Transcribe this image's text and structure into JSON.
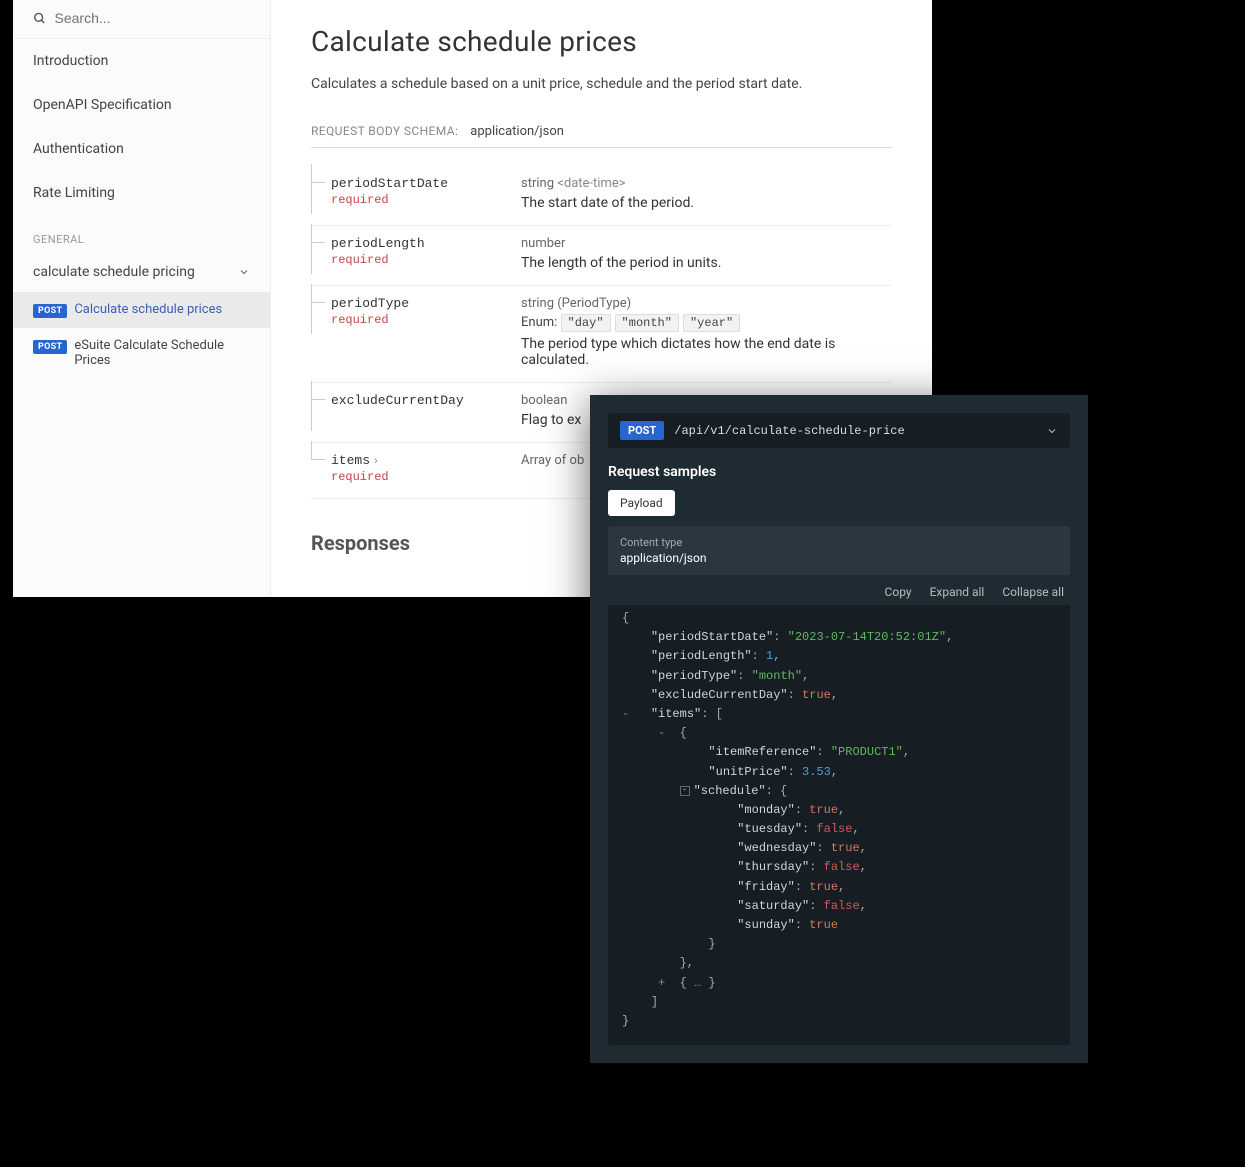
{
  "search": {
    "placeholder": "Search..."
  },
  "sidebar": {
    "items": [
      {
        "label": "Introduction"
      },
      {
        "label": "OpenAPI Specification"
      },
      {
        "label": "Authentication"
      },
      {
        "label": "Rate Limiting"
      }
    ],
    "section_header": "GENERAL",
    "group_label": "calculate schedule pricing",
    "api_items": [
      {
        "method": "POST",
        "label": "Calculate schedule prices",
        "active": true
      },
      {
        "method": "POST",
        "label": "eSuite Calculate Schedule Prices",
        "active": false
      }
    ]
  },
  "page": {
    "title": "Calculate schedule prices",
    "description": "Calculates a schedule based on a unit price, schedule and the period start date.",
    "schema_label": "REQUEST BODY SCHEMA:",
    "schema_content_type": "application/json",
    "responses_heading": "Responses"
  },
  "params": [
    {
      "name": "periodStartDate",
      "required": "required",
      "type": "string",
      "format": "<date-time>",
      "desc": "The start date of the period."
    },
    {
      "name": "periodLength",
      "required": "required",
      "type": "number",
      "format": "",
      "desc": "The length of the period in units."
    },
    {
      "name": "periodType",
      "required": "required",
      "type": "string (PeriodType)",
      "format": "",
      "enum_label": "Enum:",
      "enum": [
        "\"day\"",
        "\"month\"",
        "\"year\""
      ],
      "desc": "The period type which dictates how the end date is calculated."
    },
    {
      "name": "excludeCurrentDay",
      "required": "",
      "type": "boolean",
      "format": "",
      "desc": "Flag to ex"
    },
    {
      "name": "items",
      "required": "required",
      "type": "Array of ob",
      "format": "",
      "desc": "",
      "expandable": true
    }
  ],
  "sample": {
    "endpoint_method": "POST",
    "endpoint_path": "/api/v1/calculate-schedule-price",
    "section_title": "Request samples",
    "tab_label": "Payload",
    "content_type_label": "Content type",
    "content_type_value": "application/json",
    "toolbar": {
      "copy": "Copy",
      "expand": "Expand all",
      "collapse": "Collapse all"
    },
    "json": {
      "periodStartDate": "2023-07-14T20:52:01Z",
      "periodLength": 1,
      "periodType": "month",
      "excludeCurrentDay": true,
      "items": [
        {
          "itemReference": "PRODUCT1",
          "unitPrice": 3.53,
          "schedule": {
            "monday": true,
            "tuesday": false,
            "wednesday": true,
            "thursday": false,
            "friday": true,
            "saturday": false,
            "sunday": true
          }
        }
      ]
    }
  }
}
